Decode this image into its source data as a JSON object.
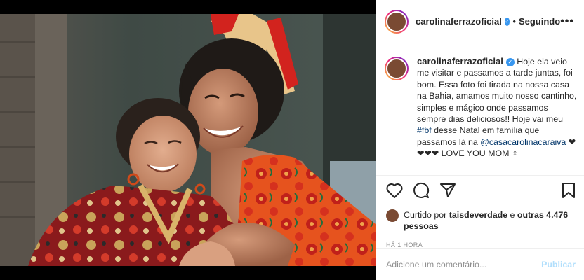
{
  "post": {
    "username": "carolinaferrazoficial",
    "follow_label": "Seguindo",
    "separator": "•",
    "more_label": "•••",
    "verified_mark": "✓"
  },
  "caption": {
    "username": "carolinaferrazoficial",
    "text_1": " Hoje ela veio me visitar e passamos a tarde juntas, foi bom. Essa foto foi tirada na nossa casa na Bahia, amamos muito nosso cantinho, simples e mágico onde passamos sempre dias deliciosos!! Hoje vai meu ",
    "hashtag": "#fbf",
    "text_2": " desse Natal em família que passamos lá na ",
    "mention": "@casacarolinacaraiva",
    "text_3": " ❤❤❤❤ LOVE YOU MOM ♀"
  },
  "likes": {
    "prefix": "Curtido por ",
    "liker": "taisdeverdade",
    "middle": " e ",
    "others": "outras 4.476 pessoas"
  },
  "time": "HÁ 1 HORA",
  "comment": {
    "placeholder": "Adicione um comentário...",
    "publish_label": "Publicar"
  },
  "colors": {
    "verified": "#3897f0",
    "link": "#003569",
    "publish": "#b2dffc",
    "meta": "#8e8e8e"
  }
}
